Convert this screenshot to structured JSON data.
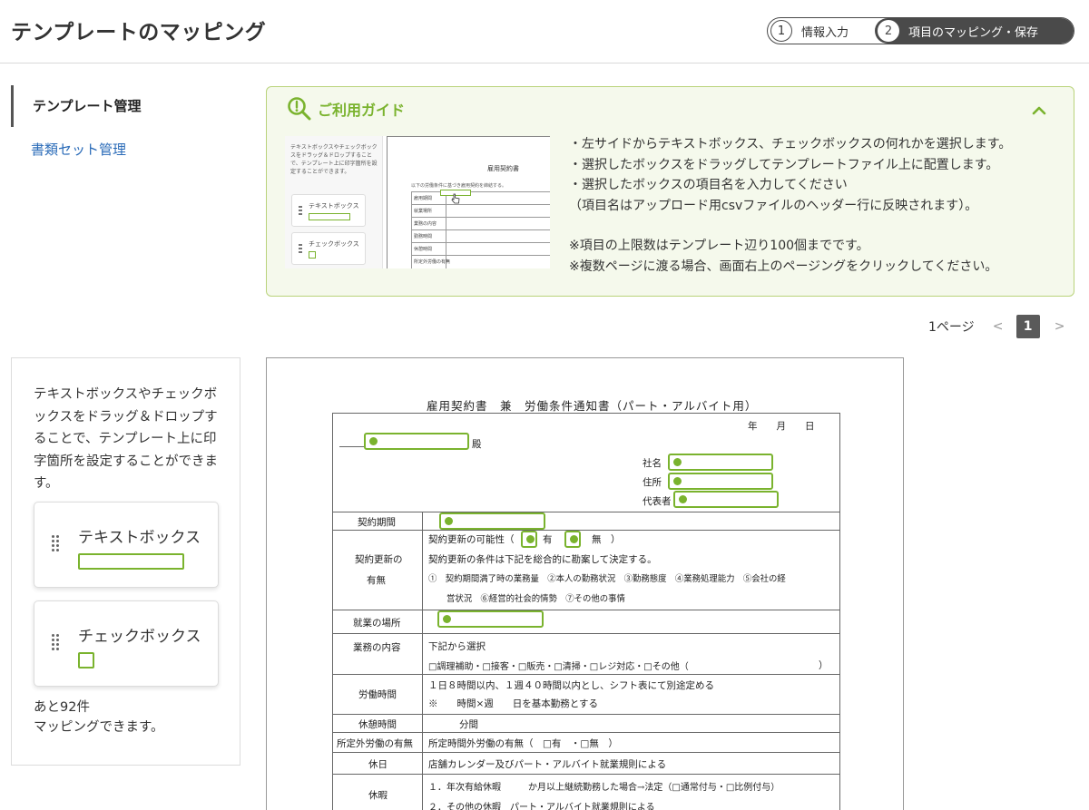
{
  "header": {
    "title": "テンプレートのマッピング",
    "steps": [
      {
        "num": "1",
        "label": "情報入力"
      },
      {
        "num": "2",
        "label": "項目のマッピング・保存"
      }
    ]
  },
  "sidenav": {
    "items": [
      {
        "label": "テンプレート管理"
      },
      {
        "label": "書類セット管理"
      }
    ]
  },
  "guide": {
    "title": "ご利用ガイド",
    "lines": [
      "・左サイドからテキストボックス、チェックボックスの何れかを選択します。",
      "・選択したボックスをドラッグしてテンプレートファイル上に配置します。",
      "・選択したボックスの項目名を入力してください",
      "（項目名はアップロード用csvファイルのヘッダー行に反映されます）。",
      "※項目の上限数はテンプレート辺り100個までです。",
      "※複数ページに渡る場合、画面右上のページングをクリックしてください。"
    ],
    "thumbnail": {
      "desc": "テキストボックスやチェックボックスをドラッグ＆ドロップすることで、テンプレート上に印字箇所を設定することができます。",
      "textbox_label": "テキストボックス",
      "checkbox_label": "チェックボックス",
      "doc_title": "雇用契約書",
      "doc_sub": "以下の労働条件に基づき雇用契約を締結する。",
      "rows": [
        "雇用期間",
        "就業場所",
        "業務の内容",
        "勤務時間",
        "休憩時間",
        "所定外労働の有無"
      ]
    }
  },
  "pagination": {
    "label": "1ページ",
    "prev": "<",
    "current": "1",
    "next": ">"
  },
  "panel": {
    "description": "テキストボックスやチェックボックスをドラッグ＆ドロップすることで、テンプレート上に印字箇所を設定することができます。",
    "tools": [
      {
        "label": "テキストボックス"
      },
      {
        "label": "チェックボックス"
      }
    ],
    "remaining_line1": "あと92件",
    "remaining_line2": "マッピングできます。"
  },
  "document": {
    "title": "雇用契約書　兼　労働条件通知書（パート・アルバイト用）",
    "date": "年　　月　　日",
    "honorific": "殿",
    "company": "社名",
    "address": "住所",
    "representative": "代表者",
    "rows": {
      "contract_period": "契約期間",
      "renewal_label1": "契約更新の",
      "renewal_label2": "有無",
      "renewal_line1a": "契約更新の可能性（",
      "renewal_line1b": "有　・",
      "renewal_line1c": "無　）",
      "renewal_line2": "契約更新の条件は下記を総合的に勘案して決定する。",
      "renewal_line3": "①　契約期間満了時の業務量　②本人の勤務状況　③勤務態度　④業務処理能力　⑤会社の経",
      "renewal_line4": "営状況　⑥経営的社会的情勢　⑦その他の事情",
      "workplace": "就業の場所",
      "duties": "業務の内容",
      "duties_line1": "下記から選択",
      "duties_line2": "□調理補助・□接客・□販売・□清掃・□レジ対応・□その他（",
      "duties_close": "）",
      "hours": "労働時間",
      "hours_line1": "１日８時間以内、１週４０時間以内とし、シフト表にて別途定める",
      "hours_line2": "※　　時間×週　　日を基本勤務とする",
      "break": "休憩時間",
      "break_value": "分間",
      "overtime": "所定外労働の有無",
      "overtime_value": "所定時間外労働の有無（　□有　・□無　）",
      "holiday": "休日",
      "holiday_value": "店舗カレンダー及びパート・アルバイト就業規則による",
      "leave": "休暇",
      "leave_line1": "１．年次有給休暇　　　か月以上継続勤務した場合→法定（□通常付与・□比例付与）",
      "leave_line2": "２．その他の休暇　パート・アルバイト就業規則による"
    }
  },
  "colors": {
    "accent": "#7ab32e",
    "guide_bg": "#f5f9ec",
    "guide_border": "#b9d37b",
    "link": "#2a6bb8",
    "dark": "#4a4a4a"
  }
}
